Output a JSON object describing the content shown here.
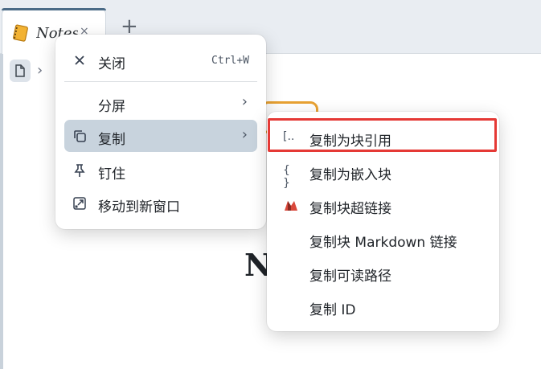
{
  "tab": {
    "title": "Notes",
    "close_glyph": "×",
    "new_tab_glyph": "+"
  },
  "breadcrumb": {
    "chevron": "›"
  },
  "page": {
    "heading_fragment": "N"
  },
  "context_menu": {
    "items": [
      {
        "label": "关闭",
        "shortcut": "Ctrl+W",
        "icon": "close-icon"
      },
      {
        "label": "分屏",
        "icon": "",
        "has_submenu": true
      },
      {
        "label": "复制",
        "icon": "copy-icon",
        "has_submenu": true,
        "active": true
      },
      {
        "label": "钉住",
        "icon": "pin-icon"
      },
      {
        "label": "移动到新窗口",
        "icon": "open-in-window-icon"
      }
    ],
    "arrow_glyph": "›"
  },
  "submenu": {
    "items": [
      {
        "label": "复制为块引用",
        "icon": "block-ref-icon",
        "icon_text": "[..",
        "highlighted": true
      },
      {
        "label": "复制为嵌入块",
        "icon": "embed-icon",
        "icon_text": "{ }"
      },
      {
        "label": "复制块超链接",
        "icon": "hyperlink-logo-icon"
      },
      {
        "label": "复制块 Markdown 链接",
        "icon": ""
      },
      {
        "label": "复制可读路径",
        "icon": ""
      },
      {
        "label": "复制 ID",
        "icon": ""
      }
    ]
  },
  "colors": {
    "highlight": "#e53935",
    "active_item_bg": "#c8d3dd",
    "tab_accent": "#4a6a86",
    "orange_frame": "#e8a233"
  }
}
